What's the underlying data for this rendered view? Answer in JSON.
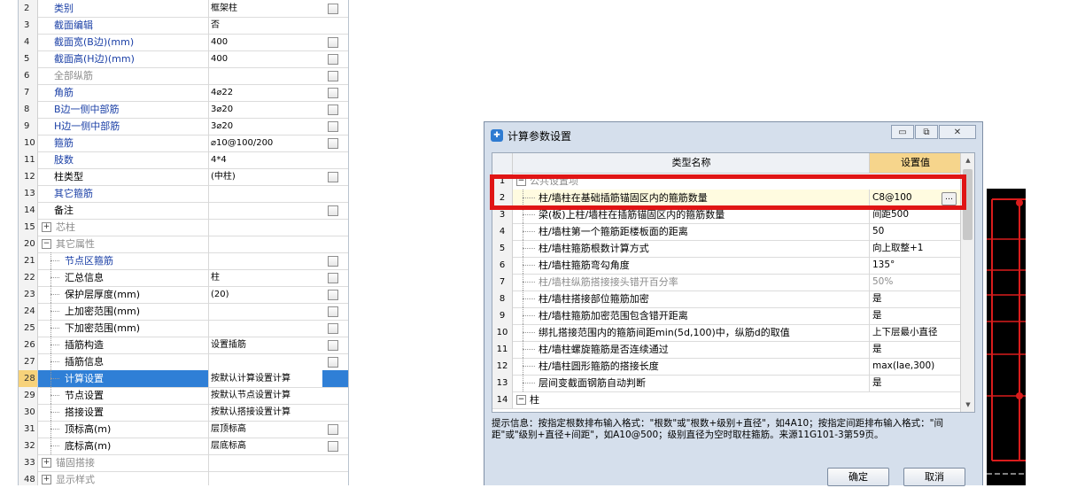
{
  "left_grid": {
    "rows": [
      {
        "num": "2",
        "name": "类别",
        "value": "框架柱",
        "style": "blue",
        "checkbox": true
      },
      {
        "num": "3",
        "name": "截面编辑",
        "value": "否",
        "style": "blue",
        "checkbox": false
      },
      {
        "num": "4",
        "name": "截面宽(B边)(mm)",
        "value": "400",
        "style": "blue",
        "checkbox": true
      },
      {
        "num": "5",
        "name": "截面高(H边)(mm)",
        "value": "400",
        "style": "blue",
        "checkbox": true
      },
      {
        "num": "6",
        "name": "全部纵筋",
        "value": "",
        "style": "gray",
        "checkbox": true
      },
      {
        "num": "7",
        "name": "角筋",
        "value": "4⌀22",
        "style": "blue",
        "checkbox": true
      },
      {
        "num": "8",
        "name": "B边一侧中部筋",
        "value": "3⌀20",
        "style": "blue",
        "checkbox": true
      },
      {
        "num": "9",
        "name": "H边一侧中部筋",
        "value": "3⌀20",
        "style": "blue",
        "checkbox": true
      },
      {
        "num": "10",
        "name": "箍筋",
        "value": "⌀10@100/200",
        "style": "blue",
        "checkbox": true
      },
      {
        "num": "11",
        "name": "肢数",
        "value": "4*4",
        "style": "blue",
        "checkbox": false
      },
      {
        "num": "12",
        "name": "柱类型",
        "value": "(中柱)",
        "style": "normal",
        "checkbox": true
      },
      {
        "num": "13",
        "name": "其它箍筋",
        "value": "",
        "style": "blue",
        "checkbox": false
      },
      {
        "num": "14",
        "name": "备注",
        "value": "",
        "style": "normal",
        "checkbox": true
      },
      {
        "num": "15",
        "name": "芯柱",
        "value": "",
        "style": "gray",
        "checkbox": false,
        "toggle": "+"
      },
      {
        "num": "20",
        "name": "其它属性",
        "value": "",
        "style": "gray",
        "checkbox": false,
        "toggle": "−"
      },
      {
        "num": "21",
        "name": "节点区箍筋",
        "value": "",
        "style": "blue",
        "checkbox": true,
        "child": true
      },
      {
        "num": "22",
        "name": "汇总信息",
        "value": "柱",
        "style": "normal",
        "checkbox": true,
        "child": true
      },
      {
        "num": "23",
        "name": "保护层厚度(mm)",
        "value": "(20)",
        "style": "normal",
        "checkbox": true,
        "child": true
      },
      {
        "num": "24",
        "name": "上加密范围(mm)",
        "value": "",
        "style": "normal",
        "checkbox": true,
        "child": true
      },
      {
        "num": "25",
        "name": "下加密范围(mm)",
        "value": "",
        "style": "normal",
        "checkbox": true,
        "child": true
      },
      {
        "num": "26",
        "name": "插筋构造",
        "value": "设置插筋",
        "style": "normal",
        "checkbox": true,
        "child": true
      },
      {
        "num": "27",
        "name": "插筋信息",
        "value": "",
        "style": "normal",
        "checkbox": true,
        "child": true
      },
      {
        "num": "28",
        "name": "计算设置",
        "value": "按默认计算设置计算",
        "style": "normal",
        "checkbox": false,
        "child": true,
        "selected": true
      },
      {
        "num": "29",
        "name": "节点设置",
        "value": "按默认节点设置计算",
        "style": "normal",
        "checkbox": false,
        "child": true
      },
      {
        "num": "30",
        "name": "搭接设置",
        "value": "按默认搭接设置计算",
        "style": "normal",
        "checkbox": false,
        "child": true
      },
      {
        "num": "31",
        "name": "顶标高(m)",
        "value": "层顶标高",
        "style": "normal",
        "checkbox": true,
        "child": true
      },
      {
        "num": "32",
        "name": "底标高(m)",
        "value": "层底标高",
        "style": "normal",
        "checkbox": true,
        "child": true
      },
      {
        "num": "33",
        "name": "锚固搭接",
        "value": "",
        "style": "gray",
        "checkbox": false,
        "toggle": "+"
      },
      {
        "num": "48",
        "name": "显示样式",
        "value": "",
        "style": "gray",
        "checkbox": false,
        "toggle": "+"
      }
    ]
  },
  "dialog": {
    "title": "计算参数设置",
    "window_buttons": {
      "minimize": "▭",
      "restore": "⧉",
      "close": "✕"
    },
    "header": {
      "name": "类型名称",
      "value": "设置值"
    },
    "rows": [
      {
        "num": "1",
        "name": "公共设置项",
        "value": "",
        "group": true,
        "toggle": "−"
      },
      {
        "num": "2",
        "name": "柱/墙柱在基础插筋锚固区内的箍筋数量",
        "value": "C8@100",
        "highlight": true
      },
      {
        "num": "3",
        "name": "梁(板)上柱/墙柱在插筋锚固区内的箍筋数量",
        "value": "间距500"
      },
      {
        "num": "4",
        "name": "柱/墙柱第一个箍筋距楼板面的距离",
        "value": "50"
      },
      {
        "num": "5",
        "name": "柱/墙柱箍筋根数计算方式",
        "value": "向上取整+1"
      },
      {
        "num": "6",
        "name": "柱/墙柱箍筋弯勾角度",
        "value": "135°"
      },
      {
        "num": "7",
        "name": "柱/墙柱纵筋搭接接头错开百分率",
        "value": "50%",
        "gray": true
      },
      {
        "num": "8",
        "name": "柱/墙柱搭接部位箍筋加密",
        "value": "是"
      },
      {
        "num": "9",
        "name": "柱/墙柱箍筋加密范围包含错开距离",
        "value": "是"
      },
      {
        "num": "10",
        "name": "绑扎搭接范围内的箍筋间距min(5d,100)中，纵筋d的取值",
        "value": "上下层最小直径"
      },
      {
        "num": "11",
        "name": "柱/墙柱螺旋箍筋是否连续通过",
        "value": "是"
      },
      {
        "num": "12",
        "name": "柱/墙柱圆形箍筋的搭接长度",
        "value": "max(lae,300)"
      },
      {
        "num": "13",
        "name": "层间变截面钢筋自动判断",
        "value": "是"
      },
      {
        "num": "14",
        "name": "柱",
        "value": "",
        "group": true,
        "toggle": "−"
      }
    ],
    "ellipsis": "…",
    "hint": "提示信息：按指定根数排布输入格式：\"根数\"或\"根数+级别+直径\"，如4A10；按指定间距排布输入格式：\"间距\"或\"级别+直径+间距\"，如A10@500；级别直径为空时取柱箍筋。来源11G101-3第59页。",
    "ok_label": "确定",
    "cancel_label": "取消"
  },
  "colors": {
    "highlight_box": "#e01515",
    "selected_row": "#2f7fd6",
    "header_value": "#f6d58c",
    "blue_text": "#1a3fa6"
  }
}
